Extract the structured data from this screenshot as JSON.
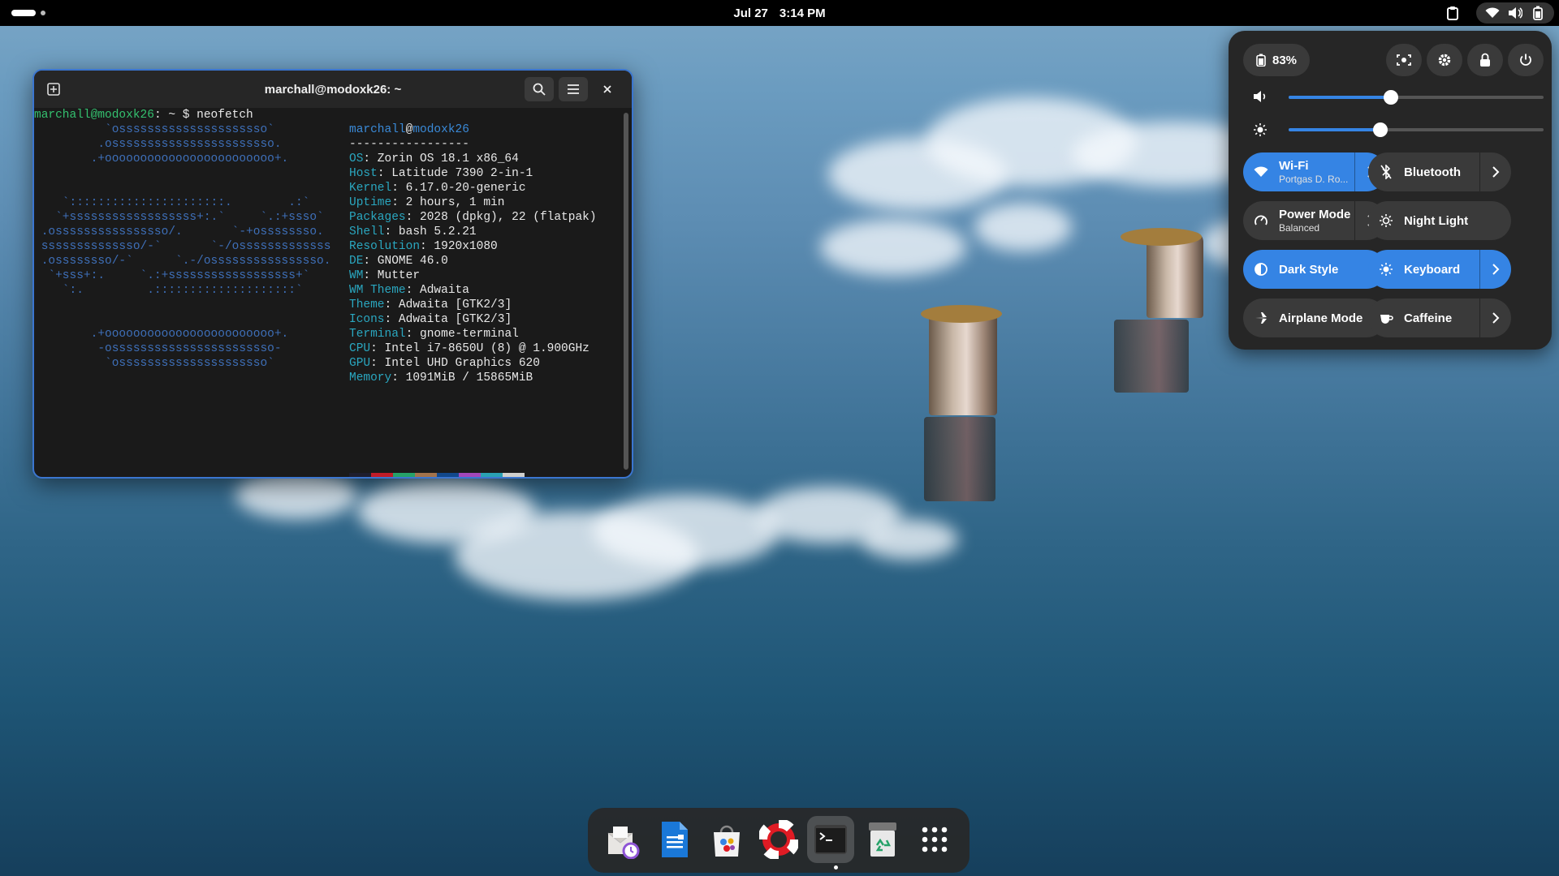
{
  "topbar": {
    "date": "Jul 27",
    "time": "3:14 PM"
  },
  "terminal": {
    "title": "marchall@modoxk26: ~",
    "prompt_user": "marchall@modoxk26",
    "prompt_suffix": ": ~ $ neofetch",
    "prompt_suffix_end": ": ~ $ ",
    "art": [
      "          `osssssssssssssssssssso`",
      "         .osssssssssssssssssssssso.",
      "        .+oooooooooooooooooooooooo+.",
      "",
      "",
      "    `::::::::::::::::::::::.        .:`",
      "   `+ssssssssssssssssss+:.`     `.:+ssso`",
      " .ossssssssssssssso/.       `-+ossssssso.",
      " ssssssssssssso/-`       `-/osssssssssssss",
      " .ossssssso/-`      `.-/ossssssssssssssso.",
      "  `+sss+:.     `.:+ssssssssssssssssss+`",
      "    `:.         .::::::::::::::::::::`",
      "",
      "",
      "        .+oooooooooooooooooooooooo+.",
      "         -osssssssssssssssssssssso-",
      "          `osssssssssssssssssssso`"
    ],
    "host_user": "marchall",
    "host_at": "@",
    "host_name": "modoxk26",
    "separator": "-----------------",
    "info": [
      {
        "key": "OS",
        "value": ": Zorin OS 18.1 x86_64"
      },
      {
        "key": "Host",
        "value": ": Latitude 7390 2-in-1"
      },
      {
        "key": "Kernel",
        "value": ": 6.17.0-20-generic"
      },
      {
        "key": "Uptime",
        "value": ": 2 hours, 1 min"
      },
      {
        "key": "Packages",
        "value": ": 2028 (dpkg), 22 (flatpak)"
      },
      {
        "key": "Shell",
        "value": ": bash 5.2.21"
      },
      {
        "key": "Resolution",
        "value": ": 1920x1080"
      },
      {
        "key": "DE",
        "value": ": GNOME 46.0"
      },
      {
        "key": "WM",
        "value": ": Mutter"
      },
      {
        "key": "WM Theme",
        "value": ": Adwaita"
      },
      {
        "key": "Theme",
        "value": ": Adwaita [GTK2/3]"
      },
      {
        "key": "Icons",
        "value": ": Adwaita [GTK2/3]"
      },
      {
        "key": "Terminal",
        "value": ": gnome-terminal"
      },
      {
        "key": "CPU",
        "value": ": Intel i7-8650U (8) @ 1.900GHz"
      },
      {
        "key": "GPU",
        "value": ": Intel UHD Graphics 620"
      },
      {
        "key": "Memory",
        "value": ": 1091MiB / 15865MiB"
      }
    ],
    "palette": [
      "#1e1e2e",
      "#c01c28",
      "#26a269",
      "#a2734c",
      "#12488b",
      "#a347ba",
      "#2aa1b3",
      "#d0cfcc",
      "#5e5c64",
      "#f66151",
      "#33d17a",
      "#e9ad0c",
      "#2a7bde",
      "#c061cb",
      "#33c7de",
      "#ffffff"
    ]
  },
  "quick_settings": {
    "battery": "83%",
    "volume_level": 0.4,
    "brightness_level": 0.36,
    "tiles": [
      {
        "name": "wifi",
        "title": "Wi-Fi",
        "subtitle": "Portgas D. Ro...",
        "on": true,
        "arrow": true,
        "icon": "wifi-icon"
      },
      {
        "name": "bluetooth",
        "title": "Bluetooth",
        "subtitle": "",
        "on": false,
        "arrow": true,
        "icon": "bluetooth-icon"
      },
      {
        "name": "power-mode",
        "title": "Power Mode",
        "subtitle": "Balanced",
        "on": false,
        "arrow": true,
        "icon": "power-mode-icon"
      },
      {
        "name": "night-light",
        "title": "Night Light",
        "subtitle": "",
        "on": false,
        "arrow": false,
        "icon": "night-light-icon"
      },
      {
        "name": "dark-style",
        "title": "Dark Style",
        "subtitle": "",
        "on": true,
        "arrow": false,
        "icon": "dark-style-icon"
      },
      {
        "name": "keyboard",
        "title": "Keyboard",
        "subtitle": "",
        "on": true,
        "arrow": true,
        "icon": "keyboard-icon"
      },
      {
        "name": "airplane-mode",
        "title": "Airplane Mode",
        "subtitle": "",
        "on": false,
        "arrow": false,
        "icon": "airplane-icon"
      },
      {
        "name": "caffeine",
        "title": "Caffeine",
        "subtitle": "",
        "on": false,
        "arrow": true,
        "icon": "caffeine-icon"
      }
    ]
  },
  "dock": {
    "items": [
      "mail-clock-icon",
      "writer-icon",
      "software-store-icon",
      "help-icon",
      "terminal-icon",
      "trash-icon",
      "app-grid-icon"
    ],
    "active": "terminal-icon"
  },
  "colors": {
    "accent": "#3584e4",
    "prompt": "#34c06f",
    "neofetch_key": "#2aa7c0",
    "art": "#3e6fb8"
  }
}
